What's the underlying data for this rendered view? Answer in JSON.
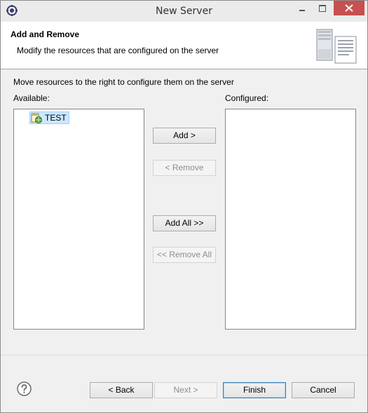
{
  "window": {
    "title": "New Server",
    "icon": "eclipse-icon"
  },
  "header": {
    "title": "Add and Remove",
    "description": "Modify the resources that are configured on the server",
    "image": "server-wizard-icon"
  },
  "main": {
    "instruction": "Move resources to the right to configure them on the server",
    "available_label": "Available:",
    "configured_label": "Configured:",
    "available_items": [
      {
        "label": "TEST",
        "icon": "web-project-icon",
        "selected": true
      }
    ],
    "configured_items": []
  },
  "buttons": {
    "add": "Add >",
    "remove": "< Remove",
    "add_all": "Add All >>",
    "remove_all": "<< Remove All"
  },
  "footer": {
    "help_icon": "help-icon",
    "back": "< Back",
    "next": "Next >",
    "finish": "Finish",
    "cancel": "Cancel"
  },
  "colors": {
    "close_button": "#c75050",
    "selection": "#cde8ff"
  }
}
